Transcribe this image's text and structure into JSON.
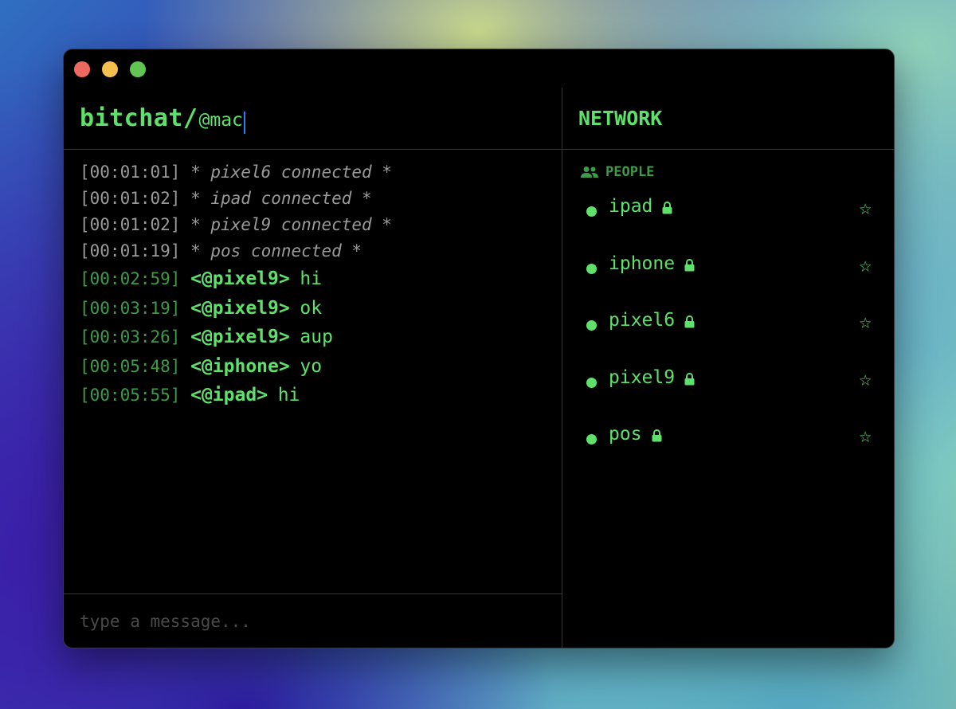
{
  "app": {
    "brand": "bitchat/",
    "nickname": "@mac"
  },
  "colors": {
    "accent": "#5fe06b",
    "timestamp_green": "#3e9b47",
    "system_gray": "#9a9a9a",
    "caret": "#2f7cf6"
  },
  "messages": [
    {
      "type": "system",
      "time": "[00:01:01]",
      "text": "* pixel6 connected *"
    },
    {
      "type": "system",
      "time": "[00:01:02]",
      "text": "* ipad connected *"
    },
    {
      "type": "system",
      "time": "[00:01:02]",
      "text": "* pixel9 connected *"
    },
    {
      "type": "system",
      "time": "[00:01:19]",
      "text": "* pos connected *"
    },
    {
      "type": "chat",
      "time": "[00:02:59]",
      "nick": "<@pixel9>",
      "text": "hi"
    },
    {
      "type": "chat",
      "time": "[00:03:19]",
      "nick": "<@pixel9>",
      "text": "ok"
    },
    {
      "type": "chat",
      "time": "[00:03:26]",
      "nick": "<@pixel9>",
      "text": "aup"
    },
    {
      "type": "chat",
      "time": "[00:05:48]",
      "nick": "<@iphone>",
      "text": "yo"
    },
    {
      "type": "chat",
      "time": "[00:05:55]",
      "nick": "<@ipad>",
      "text": "hi"
    }
  ],
  "input": {
    "placeholder": "type a message...",
    "value": ""
  },
  "network": {
    "title": "NETWORK",
    "section_label": "PEOPLE",
    "section_icon": "people-icon",
    "people": [
      {
        "name": "ipad",
        "lock_icon": "lock-icon",
        "star_icon": "star-outline-icon"
      },
      {
        "name": "iphone",
        "lock_icon": "lock-icon",
        "star_icon": "star-outline-icon"
      },
      {
        "name": "pixel6",
        "lock_icon": "lock-icon",
        "star_icon": "star-outline-icon"
      },
      {
        "name": "pixel9",
        "lock_icon": "lock-icon",
        "star_icon": "star-outline-icon"
      },
      {
        "name": "pos",
        "lock_icon": "lock-icon",
        "star_icon": "star-outline-icon"
      }
    ]
  }
}
